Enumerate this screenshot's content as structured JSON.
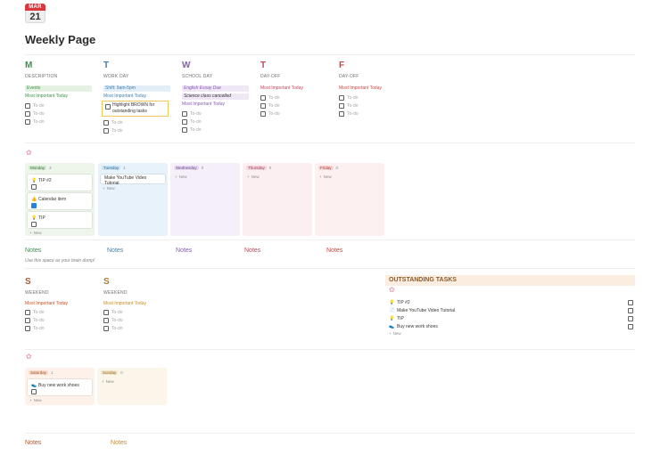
{
  "calendar_icon": {
    "month": "MAR",
    "day": "21"
  },
  "page_title": "Weekly Page",
  "days": [
    {
      "letter": "M",
      "type": "DESCRIPTION",
      "color": "#3f8f4a",
      "tag": "Events",
      "tag_bg": "#e5f2e3",
      "tag_color": "#3f8f4a",
      "mit": "Most Important Today",
      "mit_color": "#3f8f4a",
      "todos": [
        "To-do",
        "To-do",
        "To-do"
      ]
    },
    {
      "letter": "T",
      "type": "WORK DAY",
      "color": "#3f7fad",
      "tag": "Shift: 9am-5pm",
      "tag_bg": "#e1eef8",
      "tag_color": "#3f7fad",
      "mit": "Most Important Today",
      "mit_color": "#3f7fad",
      "highlight": [
        "Highlight BROWN for",
        "outstanding tasks"
      ],
      "todos": [
        "To-do",
        "To-do"
      ]
    },
    {
      "letter": "W",
      "type": "SCHOOL DAY",
      "color": "#8a5bb0",
      "tag": "English Essay Due",
      "tag_bg": "#efe6f6",
      "tag_color": "#8a5bb0",
      "tag2": "Science class cancelled",
      "mit": "Most Important Today",
      "mit_color": "#8a5bb0",
      "todos": [
        "To-do",
        "To-do",
        "To-do"
      ]
    },
    {
      "letter": "T",
      "type": "DAY-OFF",
      "color": "#c0455a",
      "mit": "Most Important Today",
      "mit_color": "#c0455a",
      "todos": [
        "To-do",
        "To-do",
        "To-do"
      ]
    },
    {
      "letter": "F",
      "type": "DAY-OFF",
      "color": "#d0433d",
      "mit": "Most Important Today",
      "mit_color": "#d0433d",
      "todos": [
        "To-do",
        "To-do",
        "To-do"
      ]
    }
  ],
  "weekday_board": {
    "columns": [
      {
        "name": "Monday",
        "count": "3",
        "bg": "#eef6ec",
        "pill": "#d4ead0",
        "fg": "#3f6f3f",
        "cards": [
          {
            "icon": "bulb",
            "title": "TIP #2",
            "checked": false
          },
          {
            "icon": "thumb",
            "title": "Calendar item",
            "checked": true
          },
          {
            "icon": "bulb",
            "title": "TIP",
            "checked": false
          }
        ]
      },
      {
        "name": "Tuesday",
        "count": "1",
        "bg": "#e8f2fa",
        "pill": "#cfe4f4",
        "fg": "#2f6a94",
        "cards": [
          {
            "icon": "",
            "title": "Make YouTube Video Tutorial",
            "checked": false
          }
        ]
      },
      {
        "name": "Wednesday",
        "count": "0",
        "bg": "#f5eff9",
        "pill": "#e6d9f0",
        "fg": "#6d4a8c",
        "cards": []
      },
      {
        "name": "Thursday",
        "count": "0",
        "bg": "#fbeff2",
        "pill": "#f3d6de",
        "fg": "#9a3d52",
        "cards": []
      },
      {
        "name": "Friday",
        "count": "0",
        "bg": "#fdf0f0",
        "pill": "#f6d8d6",
        "fg": "#a63b36",
        "cards": []
      }
    ],
    "new_label": "New"
  },
  "notes_row": {
    "labels": [
      {
        "text": "Notes",
        "color": "#3f8f4a"
      },
      {
        "text": "Notes",
        "color": "#3f7fad"
      },
      {
        "text": "Notes",
        "color": "#8a5bb0"
      },
      {
        "text": "Notes",
        "color": "#c0455a"
      },
      {
        "text": "Notes",
        "color": "#d0433d"
      }
    ],
    "hint": "Use this space as your brain dump!"
  },
  "weekend": [
    {
      "letter": "S",
      "type": "WEEKEND",
      "color": "#b6572b",
      "mit": "Most Important Today",
      "mit_color": "#c0521f",
      "todos": [
        "To-do",
        "To-do",
        "To-do"
      ]
    },
    {
      "letter": "S",
      "type": "WEEKEND",
      "color": "#b07a2f",
      "mit": "Most Important Today",
      "mit_color": "#c98a2a",
      "todos": [
        "To-do",
        "To-do",
        "To-do"
      ]
    }
  ],
  "outstanding": {
    "title": "OUTSTANDING TASKS",
    "items": [
      {
        "icon": "bulb",
        "title": "TIP #2"
      },
      {
        "icon": "doc",
        "title": "Make YouTube Video Tutorial"
      },
      {
        "icon": "bulb",
        "title": "TIP"
      },
      {
        "icon": "shoe",
        "title": "Buy new work shoes"
      }
    ],
    "new_label": "New"
  },
  "weekend_board": {
    "columns": [
      {
        "name": "Saturday",
        "count": "1",
        "bg": "#fdf1ea",
        "pill": "#f6dccd",
        "fg": "#a3522a",
        "cards": [
          {
            "icon": "shoe",
            "title": "Buy new work shoes",
            "checked": false
          }
        ]
      },
      {
        "name": "Sunday",
        "count": "0",
        "bg": "#fcf6ea",
        "pill": "#f3e6c9",
        "fg": "#8f6a22",
        "cards": []
      }
    ],
    "new_label": "New"
  },
  "weekend_notes": [
    {
      "text": "Notes",
      "color": "#c0521f"
    },
    {
      "text": "Notes",
      "color": "#c98a2a"
    }
  ]
}
